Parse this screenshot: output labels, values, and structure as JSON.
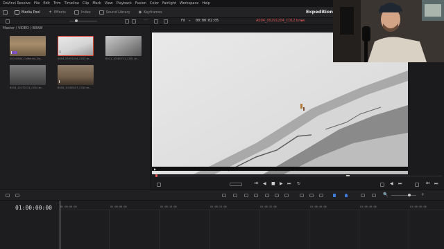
{
  "menubar": {
    "items": [
      "DaVinci Resolve",
      "File",
      "Edit",
      "Trim",
      "Timeline",
      "Clip",
      "Mark",
      "View",
      "Playback",
      "Fusion",
      "Color",
      "Fairlight",
      "Workspace",
      "Help"
    ]
  },
  "toolbar": {
    "tabs": [
      {
        "label": "Media Pool",
        "icon": "media-pool-icon",
        "active": true
      },
      {
        "label": "Effects",
        "icon": "effects-icon",
        "active": false
      },
      {
        "label": "Index",
        "icon": "index-icon",
        "active": false
      },
      {
        "label": "Sound Library",
        "icon": "sound-library-icon",
        "active": false
      },
      {
        "label": "Keyframes",
        "icon": "keyframes-icon",
        "active": false
      }
    ],
    "project_title": "Expedition"
  },
  "viewer": {
    "fit_label": "Fit",
    "timecode": "00:00:02:05",
    "clip_name": "A004_05291204_C012.braw"
  },
  "media_pool": {
    "breadcrumb": "Master / VIDEO / BRAW",
    "clips": [
      {
        "name": "20210604_California_Da...",
        "badge": true
      },
      {
        "name": "A004_05291204_C012.br...",
        "badge": false
      },
      {
        "name": "B011_10180711_C001.br...",
        "badge": false
      },
      {
        "name": "B016_10170213_C010.br...",
        "badge": false
      },
      {
        "name": "B016_10180427_C010.br...",
        "badge": false
      }
    ]
  },
  "timeline": {
    "timecode": "01:00:00:00",
    "ruler": [
      "01:00:00:00",
      "01:00:08:00",
      "01:00:16:00",
      "01:00:24:00",
      "01:00:32:00",
      "01:00:40:00",
      "01:00:48:00",
      "01:00:56:00"
    ]
  },
  "colors": {
    "accent_red": "#e05555",
    "accent_purple": "#7b4fbf",
    "accent_blue": "#3e7bd6"
  }
}
